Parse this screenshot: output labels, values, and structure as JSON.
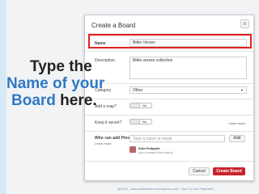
{
  "dialog": {
    "title": "Create a Board",
    "close_symbol": "×",
    "name_label": "Name",
    "name_value": "Bible Verses",
    "description_label": "Description",
    "description_value": "Bible verses collection",
    "category_label": "Category",
    "category_value": "Other",
    "map_label": "Add a map?",
    "map_toggle": "No",
    "secret_label": "Keep it secret?",
    "secret_toggle": "No",
    "secret_learn": "Learn more",
    "pinners_label": "Who can add Pins?",
    "pinners_learn": "Learn more",
    "pinners_placeholder": "Type a name or email",
    "add_label": "Add",
    "owner_name": "Sola Pettapiet",
    "owner_role": "(you created this board)",
    "cancel_label": "Cancel",
    "create_label": "Create Board"
  },
  "callout": {
    "line1": "Type the",
    "line2": "Name of your",
    "line3_blue": "Board",
    "line3_dark": " here."
  },
  "footer": "@2013 - www.solafeaturer.wordpress.com - How To Use Pinterest?",
  "colors": {
    "highlight": "#e02020",
    "create_button": "#c8232c",
    "callout_blue": "#2f79c5"
  }
}
